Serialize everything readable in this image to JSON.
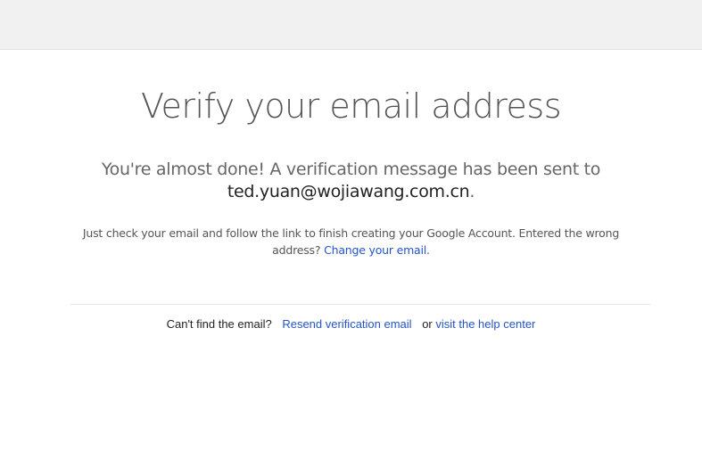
{
  "header": {},
  "main": {
    "title": "Verify your email address",
    "sent_message": "You're almost done! A verification message has been sent to",
    "email": "ted.yuan@wojiawang.com.cn",
    "email_period": ".",
    "instructions_text": "Just check your email and follow the link to finish creating your Google Account. Entered the wrong address?",
    "change_email_link": "Change your email."
  },
  "footer": {
    "cant_find_text": "Can't find the email?",
    "resend_link": "Resend verification email",
    "or_text": "or",
    "help_center_link": "visit the help center"
  },
  "colors": {
    "link": "#2554c7",
    "topbar_bg": "#f1f1f1",
    "title_text": "#555555"
  }
}
